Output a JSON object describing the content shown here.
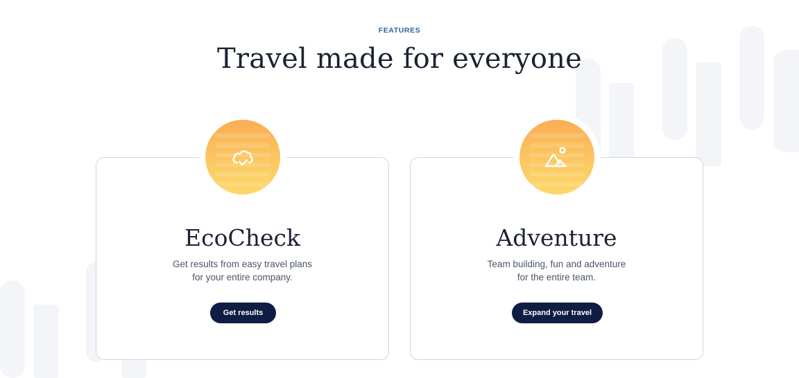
{
  "section": {
    "eyebrow": "FEATURES",
    "title": "Travel made for everyone"
  },
  "cards": [
    {
      "icon": "cloud-check-icon",
      "title": "EcoCheck",
      "description": [
        "Get results from easy travel plans",
        "for your entire company."
      ],
      "button": "Get results"
    },
    {
      "icon": "mountain-sun-icon",
      "title": "Adventure",
      "description": [
        "Team building, fun and adventure",
        "for the entire team."
      ],
      "button": "Expand your travel"
    }
  ],
  "colors": {
    "accent": "#2f5f9c",
    "button": "#0f1c44",
    "badge_top": "#f9ad55",
    "badge_bottom": "#fcd86b",
    "heading": "#1b2233"
  }
}
